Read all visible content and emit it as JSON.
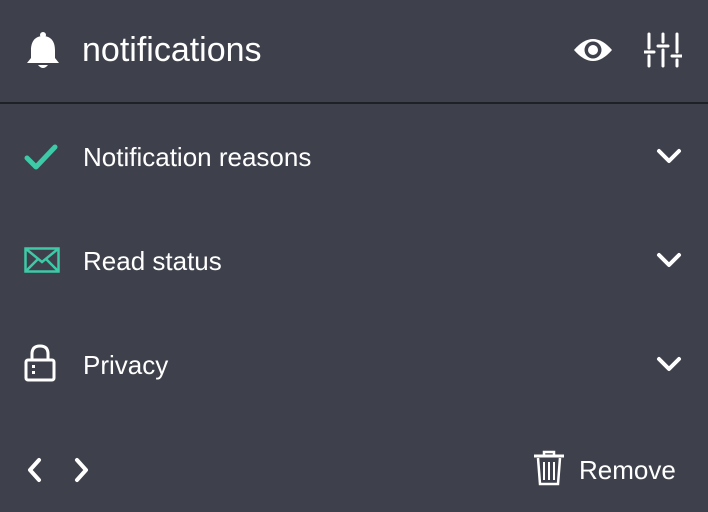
{
  "header": {
    "title": "notifications",
    "icons": {
      "leading": "bell-icon",
      "visibility": "eye-icon",
      "settings": "sliders-icon"
    }
  },
  "sections": [
    {
      "label": "Notification reasons",
      "icon": "checkmark-icon",
      "icon_color": "#3ec9a7",
      "expanded": false
    },
    {
      "label": "Read status",
      "icon": "envelope-icon",
      "icon_color": "#3ec9a7",
      "expanded": false
    },
    {
      "label": "Privacy",
      "icon": "lock-icon",
      "icon_color": "#ffffff",
      "expanded": false
    }
  ],
  "footer": {
    "remove_label": "Remove",
    "icons": {
      "prev": "chevron-left-icon",
      "next": "chevron-right-icon",
      "remove": "trash-icon"
    }
  },
  "colors": {
    "background": "#3e414b",
    "divider": "#1f2126",
    "accent": "#3ec9a7",
    "text": "#ffffff"
  }
}
